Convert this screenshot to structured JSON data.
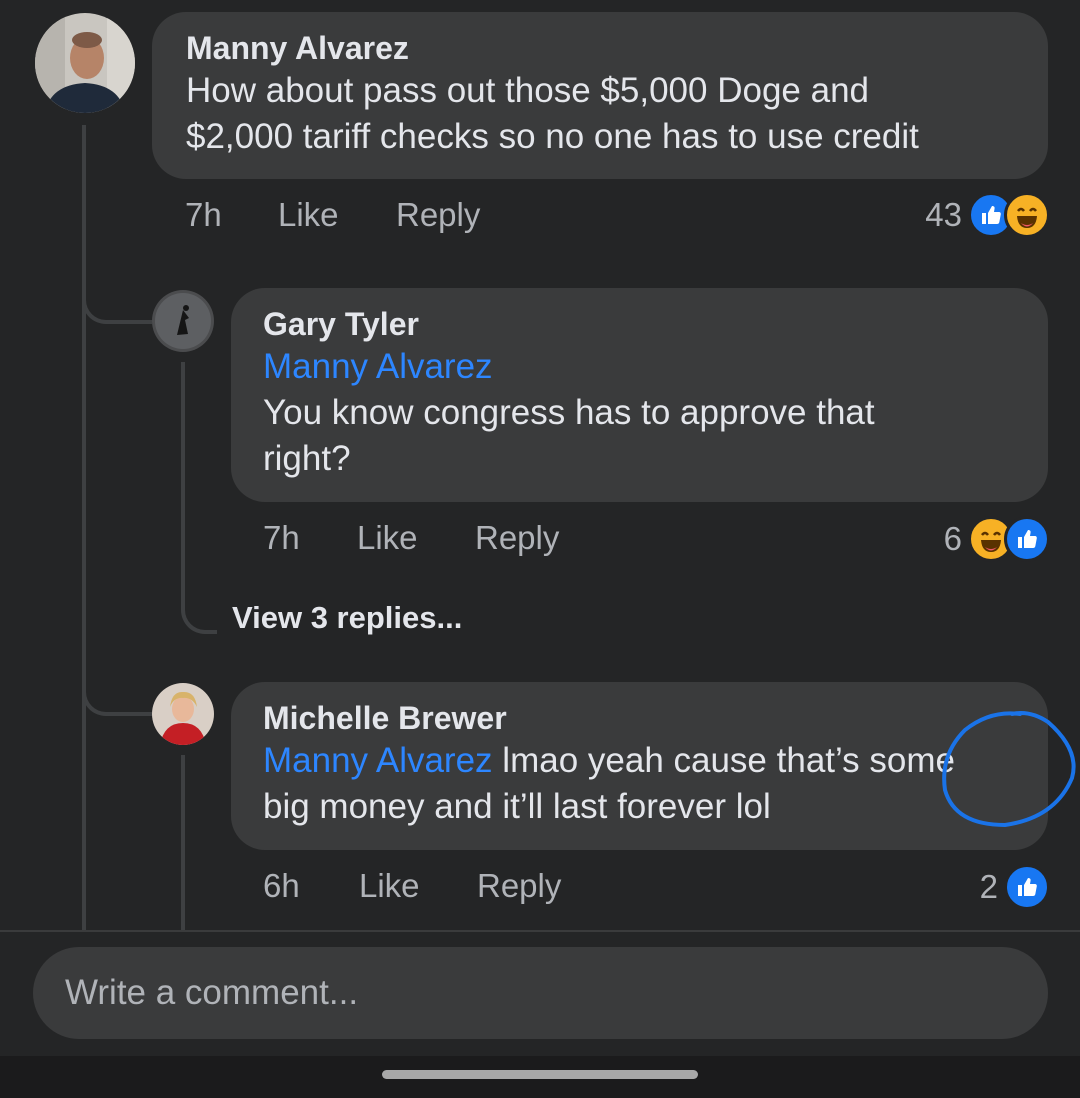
{
  "comments": {
    "manny": {
      "author": "Manny Alvarez",
      "text_line1": "How about pass out those $5,000 Doge and",
      "text_line2": "$2,000 tariff checks so no one has to use credit",
      "time": "7h",
      "like_label": "Like",
      "reply_label": "Reply",
      "reaction_count": "43"
    },
    "gary": {
      "author": "Gary Tyler",
      "mention": "Manny Alvarez",
      "text_line1": "You know congress has to approve that",
      "text_line2": "right?",
      "time": "7h",
      "like_label": "Like",
      "reply_label": "Reply",
      "reaction_count": "6",
      "view_replies": "View 3 replies..."
    },
    "michelle": {
      "author": "Michelle Brewer",
      "mention": "Manny Alvarez",
      "text_line1": "lmao yeah cause that’s some",
      "text_line2": "big money and it’ll last forever lol",
      "time": "6h",
      "like_label": "Like",
      "reply_label": "Reply",
      "reaction_count": "2"
    }
  },
  "composer": {
    "placeholder": "Write a comment..."
  },
  "colors": {
    "background": "#242526",
    "bubble": "#3a3b3c",
    "mention": "#2d86ff",
    "like_reaction": "#1877f2",
    "haha_reaction": "#f7b125",
    "annotation_circle": "#1a73e8"
  },
  "icons": [
    "like-reaction-icon",
    "haha-reaction-icon"
  ]
}
